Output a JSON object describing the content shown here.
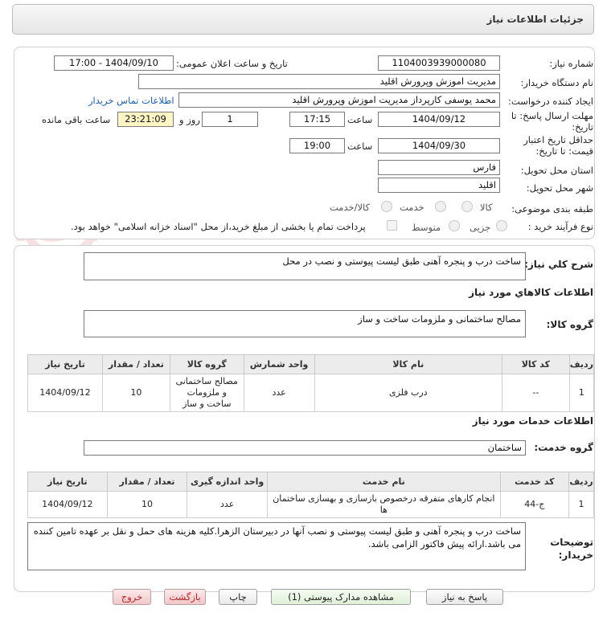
{
  "header": {
    "title": "جزئیات اطلاعات نیاز"
  },
  "info": {
    "need_number_label": "شماره نیاز:",
    "need_number": "1104003939000080",
    "announce_label": "تاریخ و ساعت اعلان عمومی:",
    "announce_value": "1404/09/10 - 17:00",
    "buyer_label": "نام دستگاه خریدار:",
    "buyer_value": "مدیریت اموزش وپرورش اقلید",
    "creator_label": "ایجاد کننده درخواست:",
    "creator_value": "محمد یوسفی کارپرداز مدیریت اموزش وپرورش اقلید",
    "contact_link": "اطلاعات تماس خریدار",
    "deadline_label_1": "مهلت ارسال پاسخ: تا",
    "deadline_label_2": "تاریخ:",
    "deadline_date": "1404/09/12",
    "time_label": "ساعت",
    "deadline_time": "17:15",
    "days_value": "1",
    "days_label": "روز و",
    "remaining_time": "23:21:09",
    "remaining_label": "ساعت باقی مانده",
    "validity_label_1": "حداقل تاریخ اعتبار",
    "validity_label_2": "قیمت: تا تاریخ:",
    "validity_date": "1404/09/30",
    "validity_time": "19:00",
    "province_label": "استان محل تحویل:",
    "province_value": "فارس",
    "city_label": "شهر محل تحویل:",
    "city_value": "اقلید",
    "category_label": "طبقه بندی موضوعی:",
    "category_options": [
      "کالا",
      "خدمت",
      "کالا/خدمت"
    ],
    "process_label": "نوع فرآیند خرید :",
    "process_options": [
      "جزیی",
      "متوسط"
    ],
    "payment_note": "پرداخت تمام یا بخشی از مبلغ خرید،از محل \"اسناد خزانه اسلامی\" خواهد بود."
  },
  "summary": {
    "label": "شرح كلي نياز:",
    "value": "ساخت درب و پنجره آهنی طبق لیست پیوستی و نصب در محل"
  },
  "goods": {
    "section_title": "اطلاعات کالاهاي مورد نياز",
    "group_label": "گروه کالا:",
    "group_value": "مصالح ساختمانی و ملزومات ساخت و ساز",
    "columns": [
      "ردیف",
      "کد کالا",
      "نام کالا",
      "واحد شمارش",
      "گروه کالا",
      "تعداد / مقدار",
      "تاریخ نیاز"
    ],
    "rows": [
      [
        "1",
        "--",
        "درب فلزی",
        "عدد",
        "مصالح ساختمانی و ملزومات ساخت و ساز",
        "10",
        "1404/09/12"
      ]
    ]
  },
  "services": {
    "section_title": "اطلاعات خدمات مورد نياز",
    "group_label": "گروه خدمت:",
    "group_value": "ساختمان",
    "columns": [
      "ردیف",
      "کد خدمت",
      "نام خدمت",
      "واحد اندازه گیری",
      "تعداد / مقدار",
      "تاریخ نیاز"
    ],
    "rows": [
      [
        "1",
        "ج-44",
        "انجام کارهای متفرقه درخصوص بازسازی و بهسازی ساختمان ها",
        "عدد",
        "10",
        "1404/09/12"
      ]
    ]
  },
  "buyer_notes": {
    "label_1": "توضیحات",
    "label_2": "خریدار:",
    "value": "ساخت درب و پنجره آهنی و طبق لیست پیوستی و نصب آنها در دبیرستان الزهرا.کلیه هزینه های حمل و نقل بر عهده تامین کننده می باشد.ارائه پیش فاکتور الزامی باشد."
  },
  "buttons": {
    "reply": "پاسخ به نیاز",
    "attachments": "مشاهده مدارک پیوستی (1)",
    "print": "چاپ",
    "back": "بازگشت",
    "exit": "خروج"
  },
  "watermark_text": "AriaTender.neT",
  "colors": {
    "accent": "#1a5fb4",
    "remaining_bg": "#fdf5c4",
    "danger": "#b22222"
  }
}
